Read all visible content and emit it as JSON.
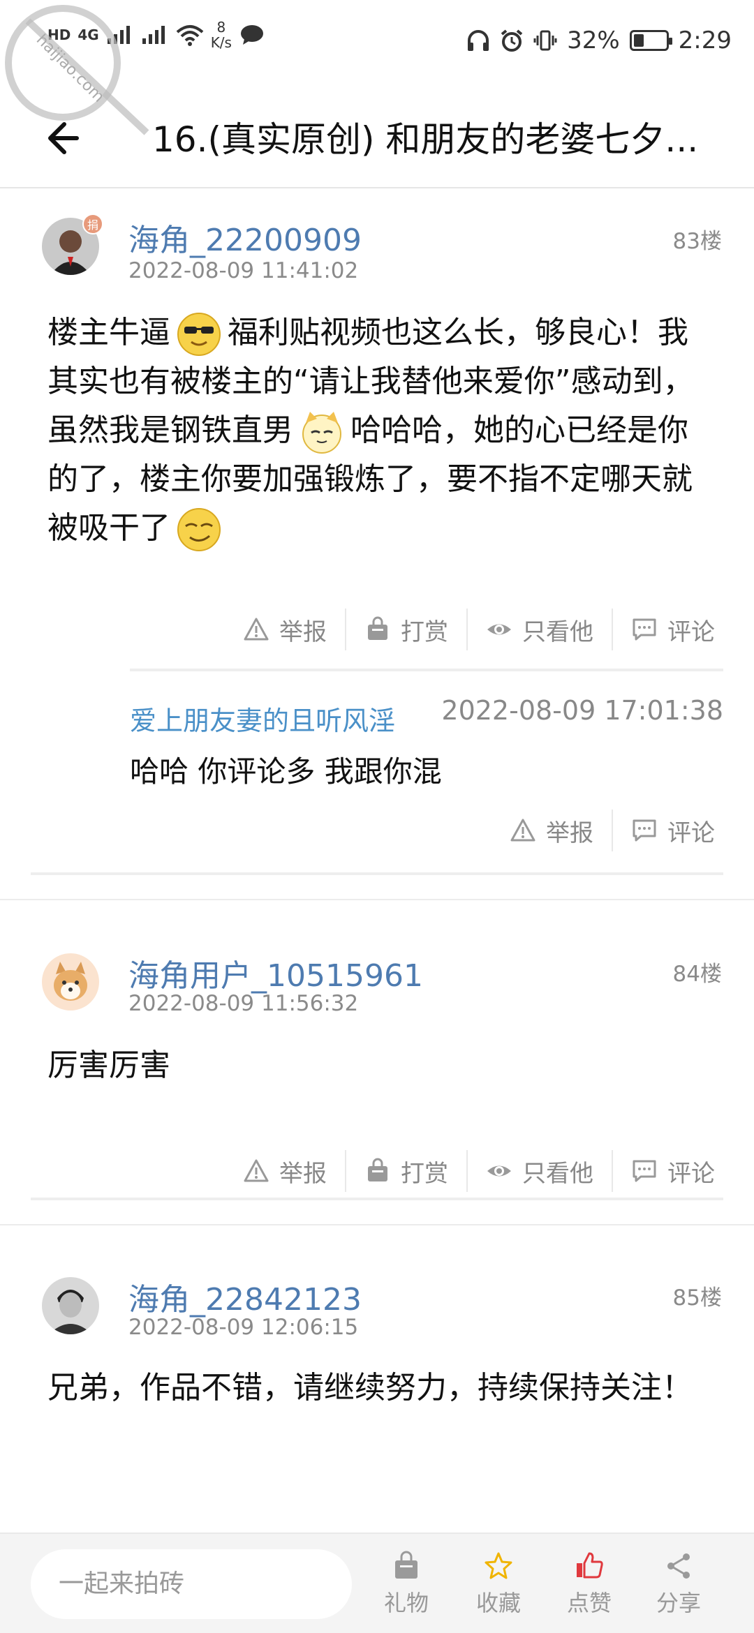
{
  "status_bar": {
    "network_left": "HD",
    "network_4g": "4G",
    "network_speed_value": "8",
    "network_speed_unit": "K/s",
    "battery_percent_text": "32%",
    "battery_level": 0.32,
    "time": "2:29"
  },
  "header": {
    "title": "16.(真实原创) 和朋友的老婆七夕..."
  },
  "posts": [
    {
      "username": "海角_22200909",
      "time": "2022-08-09 11:41:02",
      "floor": "83楼",
      "badge": "捐",
      "body_parts": [
        "楼主牛逼",
        "福利贴视频也这么长，够良心！我其实也有被楼主的“请让我替他来爱你”感动到，虽然我是钢铁直男",
        "哈哈哈，她的心已经是你的了，楼主你要加强锻炼了，要不指不定哪天就被吸干了"
      ],
      "actions": [
        "举报",
        "打赏",
        "只看他",
        "评论"
      ],
      "reply": {
        "username": "爱上朋友妻的且听风淫",
        "time": "2022-08-09 17:01:38",
        "text": "哈哈 你评论多 我跟你混",
        "actions": [
          "举报",
          "评论"
        ]
      }
    },
    {
      "username": "海角用户_10515961",
      "time": "2022-08-09 11:56:32",
      "floor": "84楼",
      "body": "厉害厉害",
      "actions": [
        "举报",
        "打赏",
        "只看他",
        "评论"
      ]
    },
    {
      "username": "海角_22842123",
      "time": "2022-08-09 12:06:15",
      "floor": "85楼",
      "body": "兄弟，作品不错，请继续努力，持续保持关注！"
    }
  ],
  "bottom_bar": {
    "input_placeholder": "一起来拍砖",
    "items": [
      "礼物",
      "收藏",
      "点赞",
      "分享"
    ],
    "accent_colors": {
      "star": "#f0b400",
      "like": "#e0393e"
    }
  },
  "watermark": {
    "text": "haijiao.com"
  }
}
